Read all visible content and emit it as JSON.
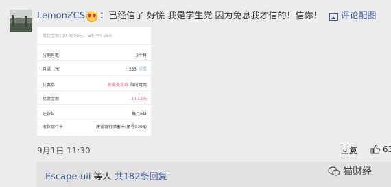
{
  "comment": {
    "username": "LemonZCS",
    "text": "：已经信了 好慌 我是学生党 因为免息我才信的！信你！",
    "pic_link": "评论配图",
    "timestamp": "9月1日 11:30",
    "reply_label": "回复",
    "like_count": "63"
  },
  "card": {
    "header": "借款金额100-3000元，日利率0.05%",
    "rows": [
      {
        "label": "分期月数",
        "value": "3个月"
      },
      {
        "label": "月供（元）",
        "value": "333",
        "sub": "详情"
      },
      {
        "label": "优惠券",
        "value": "新美免息券",
        "sub": "限时可用"
      },
      {
        "label": "优惠金额",
        "value": "-30.12元"
      },
      {
        "label": "还款日",
        "value": "每月5日"
      },
      {
        "label": "收款银行卡",
        "value": "建设银行储蓄卡(尾号0308)"
      }
    ]
  },
  "replies": {
    "user": "Escape-uii",
    "middle": " 等人 ",
    "count_link": "共182条回复"
  },
  "watermark": "猫财经",
  "colors": {
    "link": "#3b5998",
    "highlight": "#e05a8a"
  }
}
